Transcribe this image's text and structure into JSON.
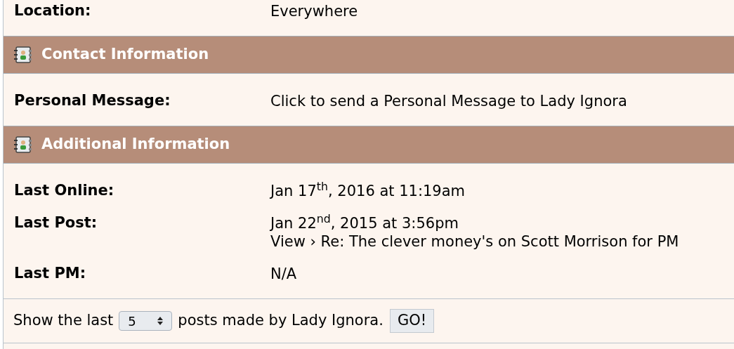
{
  "rows": [
    {
      "kind": "field",
      "label": "Location:",
      "values": [
        "Everywhere"
      ]
    },
    {
      "kind": "header",
      "title": "Contact Information"
    },
    {
      "kind": "field",
      "label": "Personal Message:",
      "values": [
        "Click to send a Personal Message to Lady Ignora"
      ]
    },
    {
      "kind": "header",
      "title": "Additional Information"
    },
    {
      "kind": "field",
      "label": "Last Online:",
      "values": [
        "Jan 17$^{th}$, 2016 at 11:19am"
      ]
    },
    {
      "kind": "field",
      "label": "Last Post:",
      "values": [
        "Jan 22$^{nd}$, 2015 at 3:56pm",
        "View › Re: The clever money's on Scott Morrison for PM"
      ]
    },
    {
      "kind": "field",
      "label": "Last PM:",
      "values": [
        "N/A"
      ]
    }
  ],
  "footer": {
    "before": "Show the last",
    "select": {
      "value": "5"
    },
    "after": "posts made by Lady Ignora.",
    "button": "GO!"
  }
}
